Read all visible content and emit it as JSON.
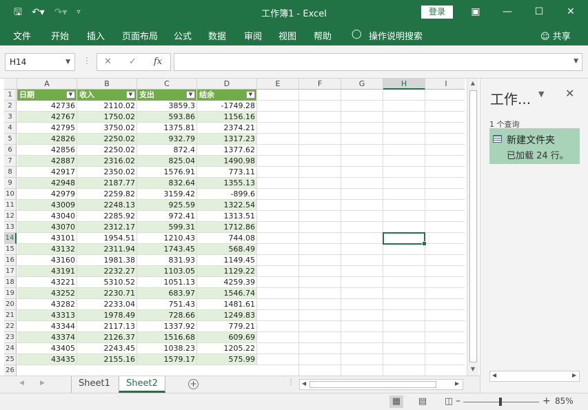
{
  "title_bar": {
    "title": "工作簿1  -  Excel",
    "login_label": "登录",
    "save_icon": "save-icon",
    "undo_icon": "undo-icon",
    "redo_icon": "redo-icon",
    "customize_icon": "customize-qat-icon"
  },
  "ribbon": {
    "tabs": [
      "文件",
      "开始",
      "插入",
      "页面布局",
      "公式",
      "数据",
      "审阅",
      "视图",
      "帮助",
      "操作说明搜索"
    ],
    "share_label": "共享"
  },
  "formula_bar": {
    "name_box": "H14",
    "fx_label": "fx",
    "formula_value": ""
  },
  "columns": [
    "A",
    "B",
    "C",
    "D",
    "E",
    "F",
    "G",
    "H",
    "I"
  ],
  "selected_column": "H",
  "selected_row": 14,
  "table_headers": [
    "日期",
    "收入",
    "支出",
    "结余"
  ],
  "rows": [
    [
      "42736",
      "2110.02",
      "3859.3",
      "-1749.28"
    ],
    [
      "42767",
      "1750.02",
      "593.86",
      "1156.16"
    ],
    [
      "42795",
      "3750.02",
      "1375.81",
      "2374.21"
    ],
    [
      "42826",
      "2250.02",
      "932.79",
      "1317.23"
    ],
    [
      "42856",
      "2250.02",
      "872.4",
      "1377.62"
    ],
    [
      "42887",
      "2316.02",
      "825.04",
      "1490.98"
    ],
    [
      "42917",
      "2350.02",
      "1576.91",
      "773.11"
    ],
    [
      "42948",
      "2187.77",
      "832.64",
      "1355.13"
    ],
    [
      "42979",
      "2259.82",
      "3159.42",
      "-899.6"
    ],
    [
      "43009",
      "2248.13",
      "925.59",
      "1322.54"
    ],
    [
      "43040",
      "2285.92",
      "972.41",
      "1313.51"
    ],
    [
      "43070",
      "2312.17",
      "599.31",
      "1712.86"
    ],
    [
      "43101",
      "1954.51",
      "1210.43",
      "744.08"
    ],
    [
      "43132",
      "2311.94",
      "1743.45",
      "568.49"
    ],
    [
      "43160",
      "1981.38",
      "831.93",
      "1149.45"
    ],
    [
      "43191",
      "2232.27",
      "1103.05",
      "1129.22"
    ],
    [
      "43221",
      "5310.52",
      "1051.13",
      "4259.39"
    ],
    [
      "43252",
      "2230.71",
      "683.97",
      "1546.74"
    ],
    [
      "43282",
      "2233.04",
      "751.43",
      "1481.61"
    ],
    [
      "43313",
      "1978.49",
      "728.66",
      "1249.83"
    ],
    [
      "43344",
      "2117.13",
      "1337.92",
      "779.21"
    ],
    [
      "43374",
      "2126.37",
      "1516.68",
      "609.69"
    ],
    [
      "43405",
      "2243.45",
      "1038.23",
      "1205.22"
    ],
    [
      "43435",
      "2155.16",
      "1579.17",
      "575.99"
    ]
  ],
  "row_numbers": [
    "1",
    "2",
    "3",
    "4",
    "5",
    "6",
    "7",
    "8",
    "9",
    "10",
    "11",
    "12",
    "13",
    "14",
    "15",
    "16",
    "17",
    "18",
    "19",
    "20",
    "21",
    "22",
    "23",
    "24",
    "25",
    "26"
  ],
  "query_pane": {
    "title": "工作...",
    "count_label": "1 个查询",
    "query_name": "新建文件夹",
    "query_status": "已加载 24 行。"
  },
  "sheets": [
    "Sheet1",
    "Sheet2"
  ],
  "active_sheet": "Sheet2",
  "status_bar": {
    "zoom_label": "85%",
    "zoom_level_percent": 85
  },
  "colors": {
    "accent": "#217346",
    "table_header": "#70ad47",
    "band": "#e2efda",
    "query_bg": "#a9d3b9"
  }
}
